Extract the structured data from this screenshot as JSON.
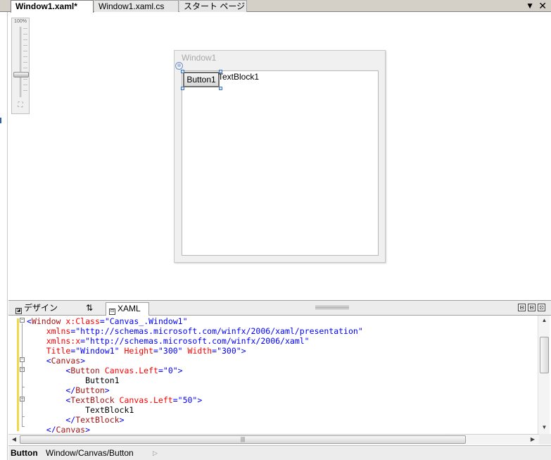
{
  "document_tabs": [
    {
      "label": "Window1.xaml*",
      "active": true
    },
    {
      "label": "Window1.xaml.cs",
      "active": false
    },
    {
      "label": "スタート ページ",
      "active": false
    }
  ],
  "tab_controls": {
    "dropdown_icon": "▼",
    "close_icon": "✕"
  },
  "zoom": {
    "label": "100%",
    "fit_icon": "⛶"
  },
  "designer": {
    "window_title": "Window1",
    "button_label": "Button1",
    "textblock_text": "TextBlock1",
    "adorner_icon": "⊕"
  },
  "view_tabs": {
    "design_label": "デザイン",
    "swap_icon": "⇅",
    "xaml_label": "XAML",
    "design_icon": "◪",
    "xaml_icon": "⊡"
  },
  "layout_buttons": [
    "⊟",
    "⊟",
    "⊡"
  ],
  "xaml_lines": [
    [
      {
        "t": "<",
        "k": "br"
      },
      {
        "t": "Window",
        "k": "tag"
      },
      {
        "t": " x:Class",
        "k": "attr"
      },
      {
        "t": "=",
        "k": "br"
      },
      {
        "t": "\"Canvas_.Window1\"",
        "k": "str"
      }
    ],
    [
      {
        "t": "    xmlns",
        "k": "attr"
      },
      {
        "t": "=",
        "k": "br"
      },
      {
        "t": "\"http://schemas.microsoft.com/winfx/2006/xaml/presentation\"",
        "k": "str"
      }
    ],
    [
      {
        "t": "    xmlns:x",
        "k": "attr"
      },
      {
        "t": "=",
        "k": "br"
      },
      {
        "t": "\"http://schemas.microsoft.com/winfx/2006/xaml\"",
        "k": "str"
      }
    ],
    [
      {
        "t": "    Title",
        "k": "attr"
      },
      {
        "t": "=",
        "k": "br"
      },
      {
        "t": "\"Window1\"",
        "k": "str"
      },
      {
        "t": " Height",
        "k": "attr"
      },
      {
        "t": "=",
        "k": "br"
      },
      {
        "t": "\"300\"",
        "k": "str"
      },
      {
        "t": " Width",
        "k": "attr"
      },
      {
        "t": "=",
        "k": "br"
      },
      {
        "t": "\"300\"",
        "k": "str"
      },
      {
        "t": ">",
        "k": "br"
      }
    ],
    [
      {
        "t": "    <",
        "k": "br"
      },
      {
        "t": "Canvas",
        "k": "tag"
      },
      {
        "t": ">",
        "k": "br"
      }
    ],
    [
      {
        "t": "        <",
        "k": "br"
      },
      {
        "t": "Button",
        "k": "tag"
      },
      {
        "t": " Canvas.Left",
        "k": "attr"
      },
      {
        "t": "=",
        "k": "br"
      },
      {
        "t": "\"0\"",
        "k": "str"
      },
      {
        "t": ">",
        "k": "br"
      }
    ],
    [
      {
        "t": "            Button1",
        "k": "txt"
      }
    ],
    [
      {
        "t": "        </",
        "k": "br"
      },
      {
        "t": "Button",
        "k": "tag"
      },
      {
        "t": ">",
        "k": "br"
      }
    ],
    [
      {
        "t": "        <",
        "k": "br"
      },
      {
        "t": "TextBlock",
        "k": "tag"
      },
      {
        "t": " Canvas.Left",
        "k": "attr"
      },
      {
        "t": "=",
        "k": "br"
      },
      {
        "t": "\"50\"",
        "k": "str"
      },
      {
        "t": ">",
        "k": "br"
      }
    ],
    [
      {
        "t": "            TextBlock1",
        "k": "txt"
      }
    ],
    [
      {
        "t": "        </",
        "k": "br"
      },
      {
        "t": "TextBlock",
        "k": "tag"
      },
      {
        "t": ">",
        "k": "br"
      }
    ],
    [
      {
        "t": "    </",
        "k": "br"
      },
      {
        "t": "Canvas",
        "k": "tag"
      },
      {
        "t": ">",
        "k": "br"
      }
    ]
  ],
  "scroll": {
    "up": "▲",
    "down": "▼",
    "left": "◀",
    "right": "▶",
    "grip": "|||"
  },
  "breadcrumb": {
    "element": "Button",
    "path": "Window/Canvas/Button",
    "arrow": "▷"
  }
}
